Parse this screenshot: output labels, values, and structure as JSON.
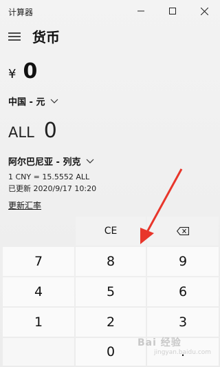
{
  "window": {
    "title": "计算器",
    "controls": [
      "minimize",
      "maximize",
      "close"
    ]
  },
  "header": {
    "menu_icon": "hamburger-icon",
    "title": "货币"
  },
  "from": {
    "symbol": "¥",
    "value": "0",
    "currency": "中国 - 元"
  },
  "to": {
    "symbol": "ALL",
    "value": "0",
    "currency": "阿尔巴尼亚 - 列克"
  },
  "rate": {
    "line1": "1 CNY = 15.5552 ALL",
    "line2": "已更新 2020/9/17 10:20",
    "update_link": "更新汇率"
  },
  "keypad": {
    "ce": "CE",
    "backspace_icon": "backspace-icon",
    "rows": [
      [
        "7",
        "8",
        "9"
      ],
      [
        "4",
        "5",
        "6"
      ],
      [
        "1",
        "2",
        "3"
      ]
    ],
    "zero": "0",
    "decimal": "."
  },
  "annotation": {
    "color": "#e8362b"
  },
  "watermark": {
    "text": "Bai 经验",
    "sub": "jingyan.baidu.com"
  }
}
